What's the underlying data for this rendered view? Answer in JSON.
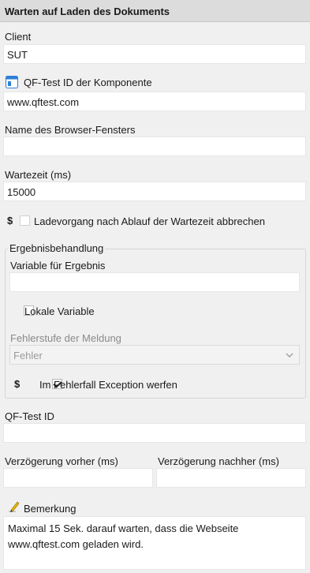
{
  "header": {
    "title": "Warten auf Laden des Dokuments"
  },
  "client": {
    "label": "Client",
    "value": "SUT"
  },
  "component": {
    "label": "QF-Test ID der Komponente",
    "value": "www.qftest.com",
    "icon": "component-window-icon"
  },
  "browser_window": {
    "label": "Name des Browser-Fensters",
    "value": ""
  },
  "timeout": {
    "label": "Wartezeit (ms)",
    "value": "15000"
  },
  "abort_option": {
    "dollar": "$",
    "label": "Ladevorgang nach Ablauf der Wartezeit abbrechen",
    "checked": false
  },
  "result_group": {
    "title": "Ergebnisbehandlung",
    "variable_label": "Variable für Ergebnis",
    "variable_value": "",
    "local_variable_label": "Lokale Variable",
    "local_variable_checked": false,
    "error_level_label": "Fehlerstufe der Meldung",
    "error_level_selected": "Fehler",
    "exception_dollar": "$",
    "exception_label": "Im Fehlerfall Exception werfen",
    "exception_checked": true
  },
  "qftest_id": {
    "label": "QF-Test ID",
    "value": ""
  },
  "delay_before": {
    "label": "Verzögerung vorher (ms)",
    "value": ""
  },
  "delay_after": {
    "label": "Verzögerung nachher (ms)",
    "value": ""
  },
  "comment": {
    "label": "Bemerkung",
    "icon": "pencil-note-icon",
    "line1": "Maximal 15 Sek. darauf warten, dass die Webseite",
    "line2": "www.qftest.com geladen wird."
  },
  "colors": {
    "background": "#f0f0f0",
    "header": "#dcdcdc",
    "field": "#ffffff",
    "icon_blue": "#2f7fd8",
    "pencil": "#e8b400"
  }
}
